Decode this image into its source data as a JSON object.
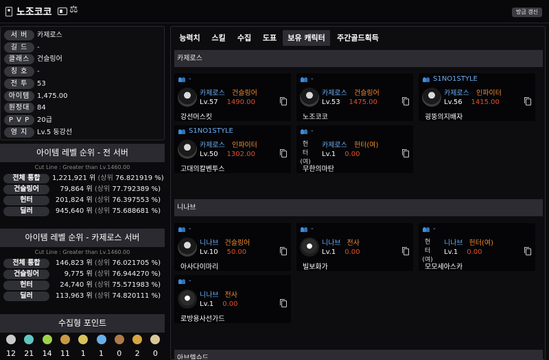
{
  "header": {
    "title": "노조코코",
    "scale_icon": "⚖",
    "refresh_label": "방금 갱신"
  },
  "profile": [
    {
      "label": "서 버",
      "value": "카제로스"
    },
    {
      "label": "길 드",
      "value": "-"
    },
    {
      "label": "클래스",
      "value": "건슬링어"
    },
    {
      "label": "칭 호",
      "value": "-"
    },
    {
      "label": "전 투",
      "value": "53"
    },
    {
      "label": "아이템",
      "value": "1,475.00"
    },
    {
      "label": "원정대",
      "value": "84"
    },
    {
      "label": "P V P",
      "value": "20급"
    },
    {
      "label": "영 지",
      "value": "Lv.5 둥강선"
    }
  ],
  "rank_all": {
    "title": "아이템 레벨 순위 - 전 서버",
    "cutline": "Cut Line : Greater than Lv.1460.00",
    "rows": [
      {
        "label": "전체 통합",
        "rank": "1,221,921",
        "unit": "위",
        "pct_prefix": "(상위",
        "pct": "76.821919 %)"
      },
      {
        "label": "건슬링어",
        "rank": "79,864",
        "unit": "위",
        "pct_prefix": "(상위",
        "pct": "77.792389 %)"
      },
      {
        "label": "헌터",
        "rank": "201,824",
        "unit": "위",
        "pct_prefix": "(상위",
        "pct": "76.397553 %)"
      },
      {
        "label": "딜러",
        "rank": "945,640",
        "unit": "위",
        "pct_prefix": "(상위",
        "pct": "75.688681 %)"
      }
    ]
  },
  "rank_server": {
    "title": "아이템 레벨 순위 - 카제로스 서버",
    "cutline": "Cut Line : Greater than Lv.1460.00",
    "rows": [
      {
        "label": "전체 통합",
        "rank": "146,823",
        "unit": "위",
        "pct_prefix": "(상위",
        "pct": "76.021705 %)"
      },
      {
        "label": "건슬링어",
        "rank": "9,775",
        "unit": "위",
        "pct_prefix": "(상위",
        "pct": "76.944270 %)"
      },
      {
        "label": "헌터",
        "rank": "24,740",
        "unit": "위",
        "pct_prefix": "(상위",
        "pct": "75.571983 %)"
      },
      {
        "label": "딜러",
        "rank": "113,963",
        "unit": "위",
        "pct_prefix": "(상위",
        "pct": "74.820111 %)"
      }
    ]
  },
  "collect": {
    "title": "수집형 포인트",
    "items": [
      {
        "icon": "mokoko-seed-icon",
        "color": "#c9c9c9",
        "value": "12"
      },
      {
        "icon": "island-heart-icon",
        "color": "#5fc7c0",
        "value": "21"
      },
      {
        "icon": "giant-heart-icon",
        "color": "#9fd34a",
        "value": "14"
      },
      {
        "icon": "art-icon",
        "color": "#c89a45",
        "value": "11"
      },
      {
        "icon": "voyage-icon",
        "color": "#d8c25a",
        "value": "1"
      },
      {
        "icon": "world-tree-leaf-icon",
        "color": "#6ab0e8",
        "value": "1"
      },
      {
        "icon": "ignea-token-icon",
        "color": "#b0794a",
        "value": "0"
      },
      {
        "icon": "orpheus-star-icon",
        "color": "#d8a540",
        "value": "2"
      },
      {
        "icon": "omnium-star-icon",
        "color": "#d9c79a",
        "value": "0"
      }
    ]
  },
  "tabs": [
    "능력치",
    "스킬",
    "수집",
    "도표",
    "보유 캐릭터",
    "주간골드획득"
  ],
  "active_tab": "보유 캐릭터",
  "servers": [
    {
      "name": "카제로스",
      "characters": [
        {
          "guild": "-",
          "server": "카제로스",
          "class": "건슬링어",
          "level": "Lv.57",
          "item_level": "1490.00",
          "name": "강선머스킷",
          "avatar": "portrait"
        },
        {
          "guild": "-",
          "server": "카제로스",
          "class": "건슬링어",
          "level": "Lv.53",
          "item_level": "1475.00",
          "name": "노조코코",
          "avatar": "portrait"
        },
        {
          "guild": "S1NO1STYLE",
          "server": "카제로스",
          "class": "인파이터",
          "level": "Lv.56",
          "item_level": "1415.00",
          "name": "굉뚱의지배자",
          "avatar": "portrait"
        },
        {
          "guild": "S1NO1STYLE",
          "server": "카제로스",
          "class": "인파이터",
          "level": "Lv.50",
          "item_level": "1302.00",
          "name": "고대의칼벤투스",
          "avatar": "portrait"
        },
        {
          "guild": "-",
          "server": "카제로스",
          "class": "헌터(여)",
          "level": "Lv.1",
          "item_level": "0.00",
          "name": "무한의마탄",
          "avatar": "broken",
          "alt": "헌터(여)"
        }
      ]
    },
    {
      "name": "니나브",
      "characters": [
        {
          "guild": "-",
          "server": "니나브",
          "class": "건슬링어",
          "level": "Lv.10",
          "item_level": "50.00",
          "name": "아사다이마리",
          "avatar": "portrait"
        },
        {
          "guild": "-",
          "server": "니나브",
          "class": "전사",
          "level": "Lv.1",
          "item_level": "0.00",
          "name": "빌보화가",
          "avatar": "mask"
        },
        {
          "guild": "-",
          "server": "니나브",
          "class": "헌터(여)",
          "level": "Lv.1",
          "item_level": "0.00",
          "name": "모모세아스카",
          "avatar": "broken",
          "alt": "헌터(여)"
        },
        {
          "guild": "-",
          "server": "니나브",
          "class": "전사",
          "level": "Lv.1",
          "item_level": "0.00",
          "name": "로방용사선가드",
          "avatar": "mask"
        }
      ]
    },
    {
      "name": "아브렐슈드",
      "characters": []
    }
  ]
}
